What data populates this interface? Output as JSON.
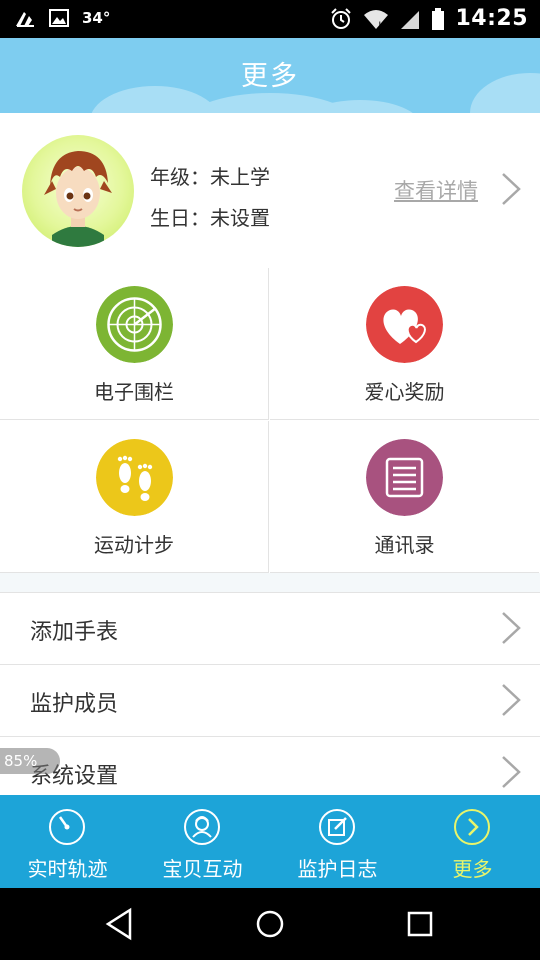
{
  "status_bar": {
    "temperature": "34°",
    "time": "14:25"
  },
  "header": {
    "title": "更多"
  },
  "profile": {
    "grade_label": "年级：",
    "grade_value": "未上学",
    "birthday_label": "生日：",
    "birthday_value": "未设置",
    "detail_link": "查看详情"
  },
  "features": [
    {
      "label": "电子围栏",
      "icon": "radar-icon",
      "color": "#7db533"
    },
    {
      "label": "爱心奖励",
      "icon": "hearts-icon",
      "color": "#e24341"
    },
    {
      "label": "运动计步",
      "icon": "footprints-icon",
      "color": "#ecc71a"
    },
    {
      "label": "通讯录",
      "icon": "contacts-list-icon",
      "color": "#a8527f"
    }
  ],
  "menu": [
    {
      "label": "添加手表"
    },
    {
      "label": "监护成员"
    },
    {
      "label": "系统设置"
    }
  ],
  "overlay": {
    "battery_text": "85%"
  },
  "tabbar": {
    "items": [
      {
        "label": "实时轨迹",
        "icon": "realtime-track-icon"
      },
      {
        "label": "宝贝互动",
        "icon": "baby-interact-icon"
      },
      {
        "label": "监护日志",
        "icon": "edit-log-icon"
      },
      {
        "label": "更多",
        "icon": "more-arrow-icon",
        "active": true
      }
    ],
    "active_color": "#e9f56a"
  },
  "colors": {
    "header": "#7ecdf0",
    "tabbar": "#1da4d8"
  }
}
